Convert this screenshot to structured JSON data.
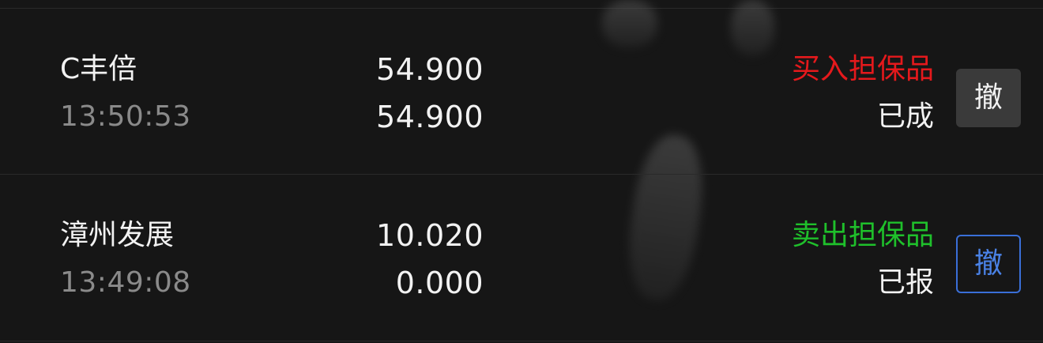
{
  "orders": [
    {
      "name": "C丰倍",
      "time": "13:50:53",
      "order_price": "54.900",
      "filled_price": "54.900",
      "side": "买入担保品",
      "side_color": "#e5191c",
      "status": "已成",
      "cancel_label": "撤",
      "cancel_enabled": false
    },
    {
      "name": "漳州发展",
      "time": "13:49:08",
      "order_price": "10.020",
      "filled_price": "0.000",
      "side": "卖出担保品",
      "side_color": "#1fc02b",
      "status": "已报",
      "cancel_label": "撤",
      "cancel_enabled": true
    }
  ],
  "colors": {
    "background": "#161616",
    "cancel_active": "#3a6fd8"
  }
}
